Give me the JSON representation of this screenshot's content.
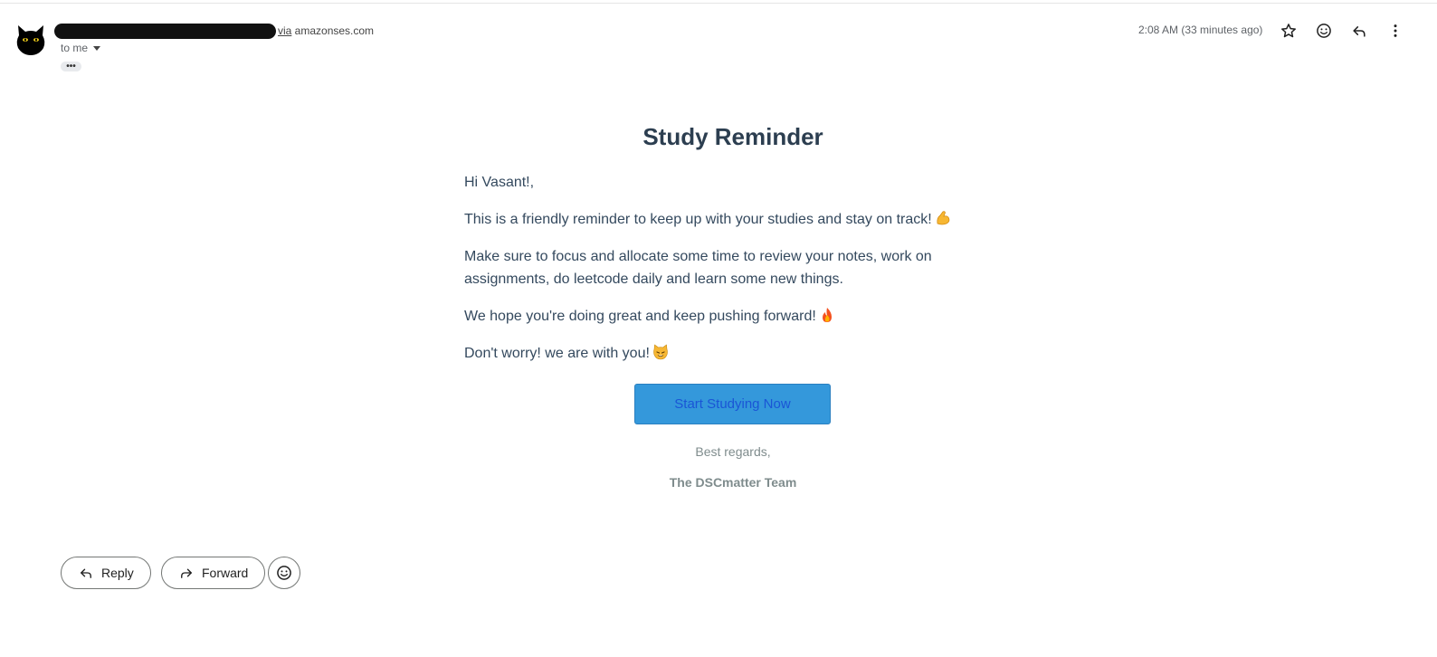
{
  "header": {
    "sender_via_word": "via",
    "sender_domain": " amazonses.com",
    "recipient": "to me",
    "timestamp": "2:08 AM (33 minutes ago)",
    "icons": [
      "star-icon",
      "emoji-react-icon",
      "reply-icon",
      "more-vert-icon"
    ]
  },
  "email": {
    "title": "Study Reminder",
    "greeting": "Hi Vasant!,",
    "p1": "This is a friendly reminder to keep up with your studies and stay on track!",
    "p2": "Make sure to focus and allocate some time to review your notes, work on assignments, do leetcode daily and learn some new things.",
    "p3": "We hope you're doing great and keep pushing forward!",
    "p4": "Don't worry! we are with you!",
    "cta_label": "Start Studying Now",
    "closing": "Best regards,",
    "signature": "The DSCmatter Team",
    "emojis": [
      "flexed-biceps-emoji",
      "fire-emoji",
      "cat-emoji"
    ],
    "colors": {
      "title": "#2c3e50",
      "body": "#34495e",
      "button": "#3498db",
      "muted": "#7f8c8d"
    }
  },
  "footer": {
    "reply_label": "Reply",
    "forward_label": "Forward"
  }
}
